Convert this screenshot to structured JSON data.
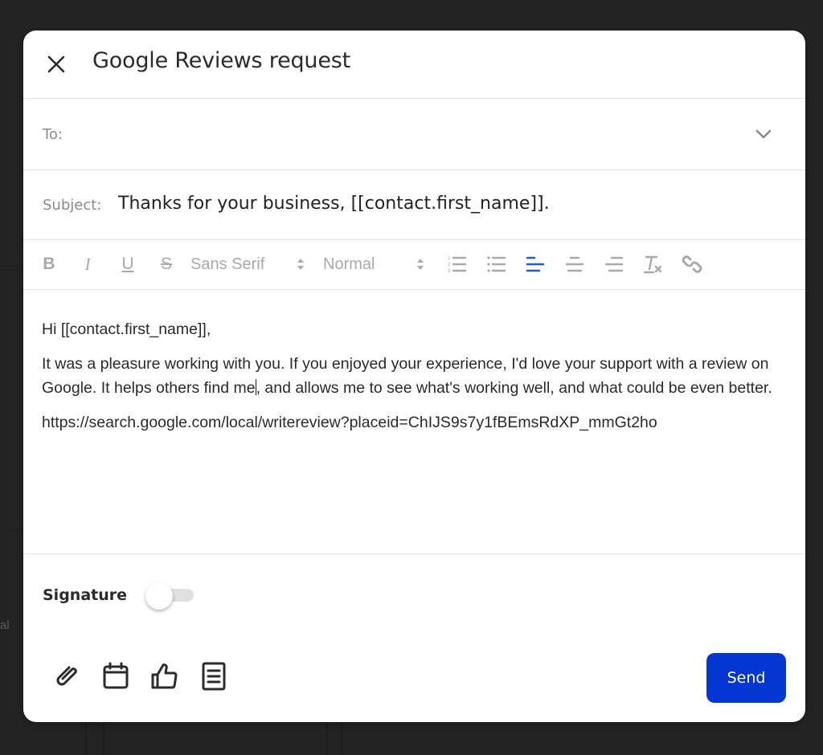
{
  "modal": {
    "title": "Google Reviews request",
    "close_icon": "close-icon"
  },
  "to": {
    "label": "To:",
    "value": "",
    "placeholder": "",
    "dropdown_icon": "chevron-down-icon"
  },
  "subject": {
    "label": "Subject:",
    "value": "Thanks for your business, [[contact.first_name]]."
  },
  "toolbar": {
    "bold": "B",
    "italic": "I",
    "underline": "U",
    "strike": "S",
    "font_family": "Sans Serif",
    "font_size": "Normal",
    "icons": [
      "ordered-list-icon",
      "bullet-list-icon",
      "align-left-icon",
      "align-center-icon",
      "align-right-icon",
      "clear-format-icon",
      "link-icon"
    ],
    "active_alignment": "left",
    "active_color": "#1a5fc9",
    "inactive_color": "#a9a9a9"
  },
  "body": {
    "greeting": "Hi [[contact.first_name]],",
    "paragraph_before_caret": "It was a pleasure working with you. If you enjoyed your experience, I'd love your support with a review on Google. It helps others find me",
    "paragraph_after_caret": ", and allows me to see what's working well, and what could be even better.",
    "link": "https://search.google.com/local/writereview?placeid=ChIJS9s7y1fBEmsRdXP_mmGt2ho"
  },
  "signature": {
    "label": "Signature",
    "enabled": false
  },
  "footer": {
    "icons": [
      "paperclip-icon",
      "calendar-icon",
      "thumbs-up-icon",
      "document-icon"
    ],
    "send_label": "Send",
    "send_color": "#0436d2"
  },
  "background": {
    "partial_text": "al"
  }
}
